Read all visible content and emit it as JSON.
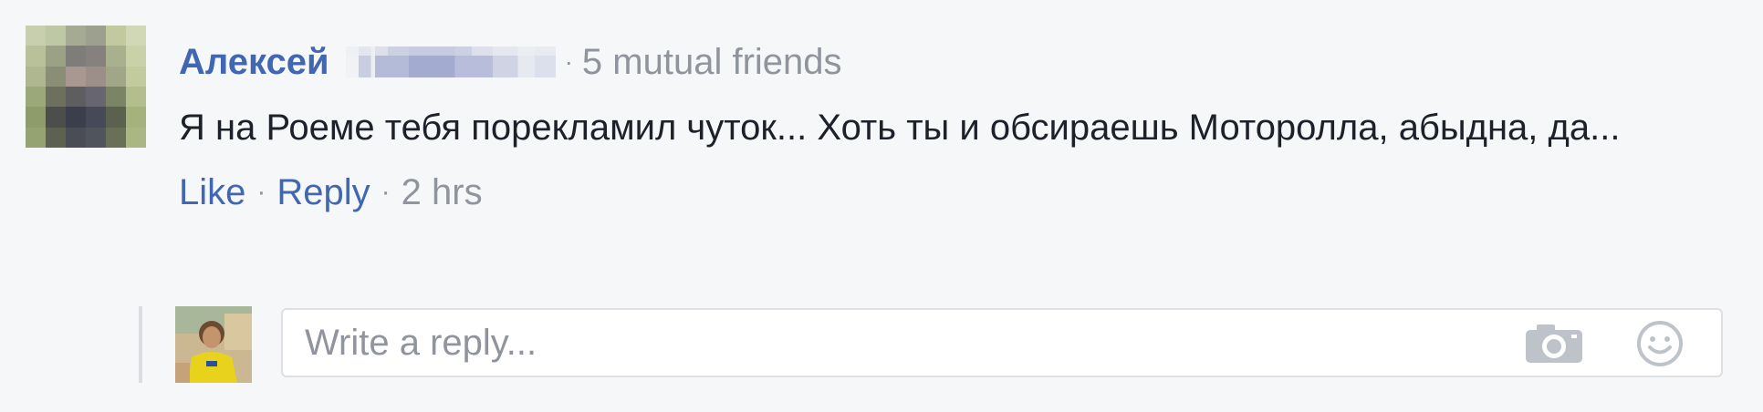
{
  "comment": {
    "author_name": "Алексей",
    "separator": "·",
    "mutual_friends": "5 mutual friends",
    "text": "Я на Роеме тебя порекламил чуток... Хоть ты и обсираешь Моторолла, абыдна, да...",
    "actions": {
      "like_label": "Like",
      "reply_label": "Reply",
      "separator": "·",
      "timestamp": "2 hrs"
    }
  },
  "reply_composer": {
    "placeholder": "Write a reply...",
    "camera_icon": "camera-icon",
    "emoji_icon": "smiley-icon"
  },
  "colors": {
    "background": "#f6f7f9",
    "link": "#4267b2",
    "muted": "#90949c",
    "text": "#1d2129",
    "input_border": "#dddfe2"
  }
}
